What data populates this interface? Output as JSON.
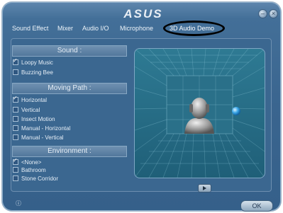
{
  "brand": "ASUS",
  "tabs": [
    {
      "label": "Sound Effect"
    },
    {
      "label": "Mixer"
    },
    {
      "label": "Audio I/O"
    },
    {
      "label": "Microphone"
    },
    {
      "label": "3D Audio Demo"
    }
  ],
  "sections": {
    "sound": {
      "title": "Sound :",
      "options": [
        {
          "label": "Loopy Music",
          "checked": true
        },
        {
          "label": "Buzzing Bee",
          "checked": false
        }
      ]
    },
    "path": {
      "title": "Moving Path :",
      "options": [
        {
          "label": "Horizontal",
          "checked": true
        },
        {
          "label": "Vertical",
          "checked": false
        },
        {
          "label": "Insect Motion",
          "checked": false
        },
        {
          "label": "Manual - Horizontal",
          "checked": false
        },
        {
          "label": "Manual - Vertical",
          "checked": false
        }
      ]
    },
    "environment": {
      "title": "Environment :",
      "options": [
        {
          "label": "<None>",
          "checked": true
        },
        {
          "label": "Bathroom",
          "checked": false
        },
        {
          "label": "Stone Corridor",
          "checked": false
        }
      ]
    }
  },
  "footer": {
    "info_label": "ⓘ",
    "ok_label": "OK"
  },
  "colors": {
    "accent": "#3a658f",
    "stage": "#1f5f78",
    "sound_source": "#3aa6e6"
  }
}
